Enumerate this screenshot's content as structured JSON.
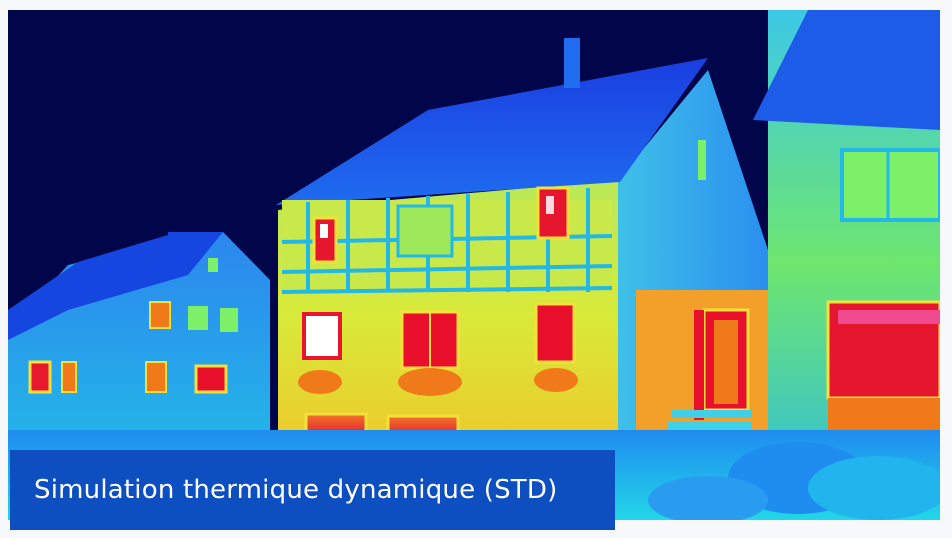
{
  "caption": {
    "text": "Simulation thermique dynamique (STD)",
    "background_color": "#0d4fc0",
    "text_color": "#ffffff"
  },
  "image": {
    "subject": "thermal-camera-view-of-houses",
    "palette": [
      "#01064a",
      "#1034d8",
      "#1f8cf0",
      "#22d6e8",
      "#7df06a",
      "#f4e03a",
      "#f07a1a",
      "#e8102a",
      "#ffffff"
    ]
  }
}
